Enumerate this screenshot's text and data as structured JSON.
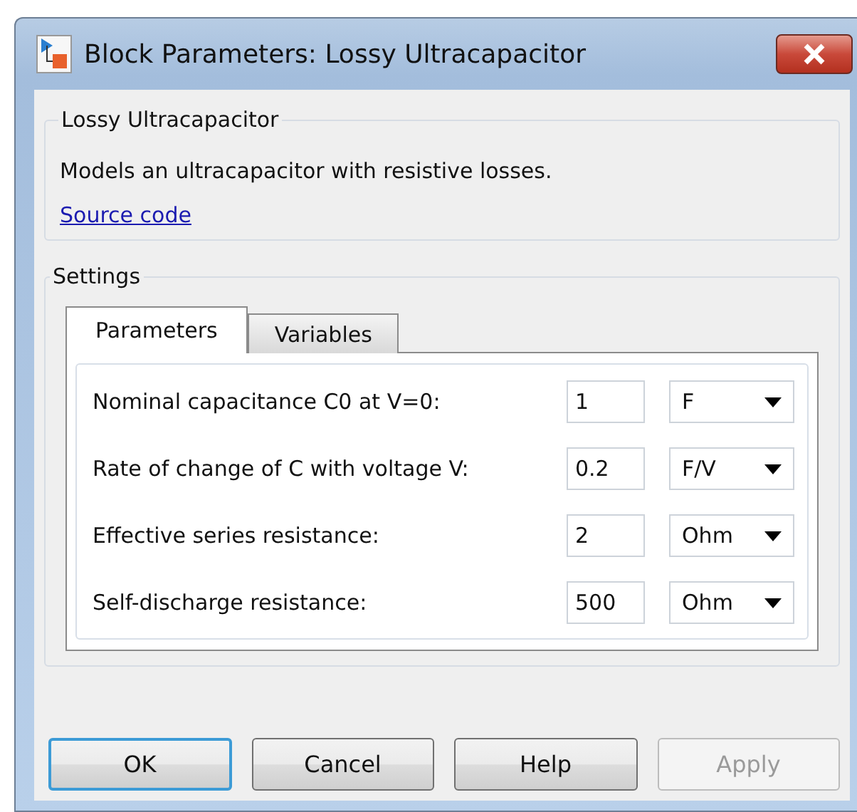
{
  "window": {
    "title": "Block Parameters: Lossy Ultracapacitor"
  },
  "description_group": {
    "title": "Lossy Ultracapacitor",
    "text": "Models an ultracapacitor with resistive losses.",
    "link": "Source code"
  },
  "settings": {
    "title": "Settings",
    "tabs": [
      {
        "label": "Parameters",
        "selected": true
      },
      {
        "label": "Variables",
        "selected": false
      }
    ],
    "parameters": [
      {
        "label": "Nominal capacitance C0 at V=0:",
        "value": "1",
        "unit": "F"
      },
      {
        "label": "Rate of change of C with voltage V:",
        "value": "0.2",
        "unit": "F/V"
      },
      {
        "label": "Effective series resistance:",
        "value": "2",
        "unit": "Ohm"
      },
      {
        "label": "Self-discharge resistance:",
        "value": "500",
        "unit": "Ohm"
      }
    ]
  },
  "buttons": [
    {
      "label": "OK",
      "default": true,
      "disabled": false
    },
    {
      "label": "Cancel",
      "default": false,
      "disabled": false
    },
    {
      "label": "Help",
      "default": false,
      "disabled": false
    },
    {
      "label": "Apply",
      "default": false,
      "disabled": true
    }
  ]
}
